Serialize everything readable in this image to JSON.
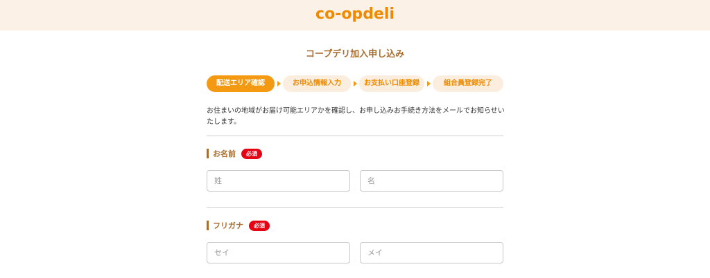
{
  "header": {
    "logo_text": "co-op",
    "logo_accent": "deli",
    "background": "#fbf1e6",
    "brand_color": "#ef8a00"
  },
  "page": {
    "title": "コープデリ加入申し込み"
  },
  "steps": [
    {
      "label": "配送エリア確認",
      "active": true
    },
    {
      "label": "お申込情報入力",
      "active": false
    },
    {
      "label": "お支払い口座登録",
      "active": false
    },
    {
      "label": "組合員登録完了",
      "active": false
    }
  ],
  "intro": {
    "text": "お住まいの地域がお届け可能エリアかを確認し、お申し込みお手続き方法をメールでお知らせいたします。"
  },
  "name_field": {
    "label": "お名前",
    "required_badge": "必須",
    "last_placeholder": "姓",
    "first_placeholder": "名",
    "last_value": "",
    "first_value": ""
  },
  "kana_field": {
    "label": "フリガナ",
    "required_badge": "必須",
    "last_placeholder": "セイ",
    "first_placeholder": "メイ",
    "last_value": "",
    "first_value": ""
  },
  "colors": {
    "accent": "#f49a12",
    "label_brown": "#a86d2e",
    "required_red": "#e60012",
    "step_inactive_bg": "#fbeede"
  }
}
